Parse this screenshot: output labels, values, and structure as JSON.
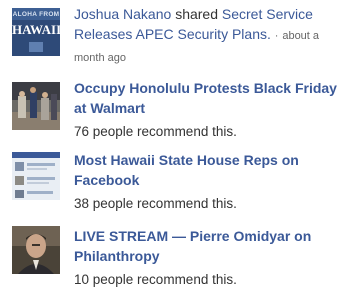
{
  "activity": {
    "actor": "Joshua Nakano",
    "verb": "shared",
    "article": "Secret Service Releases APEC Security Plans.",
    "separator": "·",
    "time": "about a month ago",
    "thumb_caption_top": "ALOHA FROM",
    "thumb_caption_main": "HAWAII"
  },
  "recommendations": [
    {
      "title": "Occupy Honolulu Protests Black Friday at Walmart",
      "count_text": "76 people recommend this."
    },
    {
      "title": "Most Hawaii State House Reps on Facebook",
      "count_text": "38 people recommend this."
    },
    {
      "title": "LIVE STREAM — Pierre Omidyar on Philanthropy",
      "count_text": "10 people recommend this."
    }
  ],
  "colors": {
    "link": "#3b5998",
    "text": "#333333",
    "muted": "#666666",
    "thumb_badge": "#2e4a78"
  }
}
